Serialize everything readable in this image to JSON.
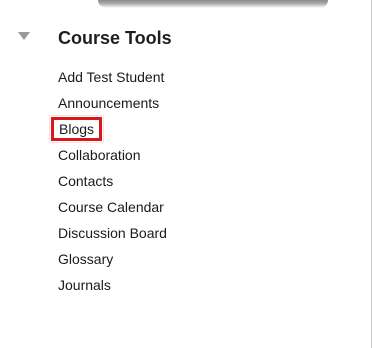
{
  "section": {
    "title": "Course Tools",
    "icon": "disclosure-triangle-icon"
  },
  "tools": [
    {
      "label": "Add Test Student",
      "highlighted": false
    },
    {
      "label": "Announcements",
      "highlighted": false
    },
    {
      "label": "Blogs",
      "highlighted": true
    },
    {
      "label": "Collaboration",
      "highlighted": false
    },
    {
      "label": "Contacts",
      "highlighted": false
    },
    {
      "label": "Course Calendar",
      "highlighted": false
    },
    {
      "label": "Discussion Board",
      "highlighted": false
    },
    {
      "label": "Glossary",
      "highlighted": false
    },
    {
      "label": "Journals",
      "highlighted": false
    }
  ],
  "colors": {
    "highlight_border": "#d7191d",
    "text": "#1a1a1a",
    "triangle": "#9a9a9a"
  }
}
